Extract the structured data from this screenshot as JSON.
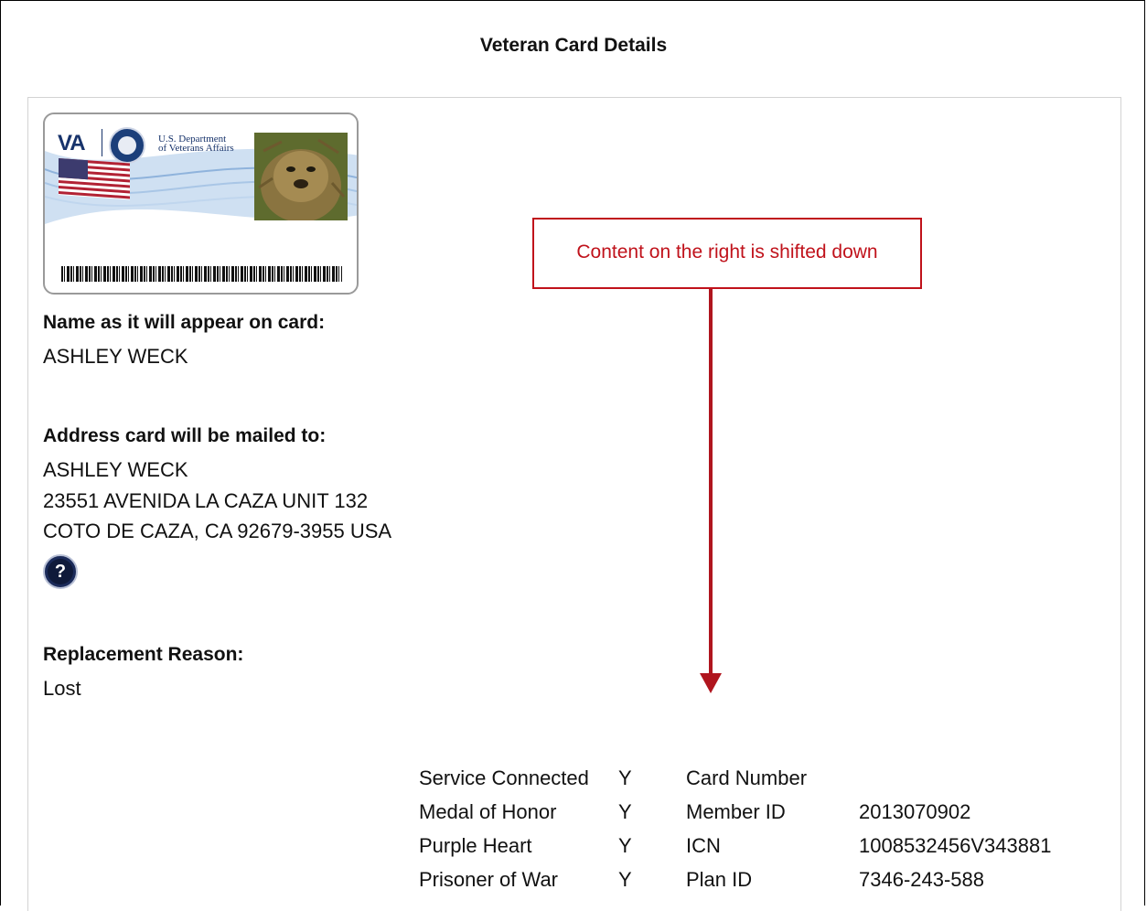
{
  "page": {
    "title": "Veteran Card Details"
  },
  "card_preview": {
    "agency_short": "VA",
    "agency_name_line1": "U.S. Department",
    "agency_name_line2": "of Veterans Affairs",
    "icons": [
      "va-seal-icon",
      "us-flag-icon",
      "barcode"
    ]
  },
  "name_section": {
    "label": "Name as it will appear on card:",
    "value": "ASHLEY WECK"
  },
  "address_section": {
    "label": "Address card will be mailed to:",
    "lines": [
      "ASHLEY WECK",
      "23551 AVENIDA LA CAZA UNIT 132",
      "COTO DE CAZA, CA 92679-3955 USA"
    ],
    "help_icon": "?"
  },
  "replacement_section": {
    "label": "Replacement Reason:",
    "value": "Lost"
  },
  "annotation": {
    "text": "Content on the right is shifted down",
    "color": "#c0121b"
  },
  "details": [
    {
      "label": "Service Connected",
      "flag": "Y",
      "field": "Card Number",
      "value": ""
    },
    {
      "label": "Medal of Honor",
      "flag": "Y",
      "field": "Member ID",
      "value": "2013070902"
    },
    {
      "label": "Purple Heart",
      "flag": "Y",
      "field": "ICN",
      "value": "1008532456V343881"
    },
    {
      "label": "Prisoner of War",
      "flag": "Y",
      "field": "Plan ID",
      "value": "7346-243-588"
    }
  ]
}
